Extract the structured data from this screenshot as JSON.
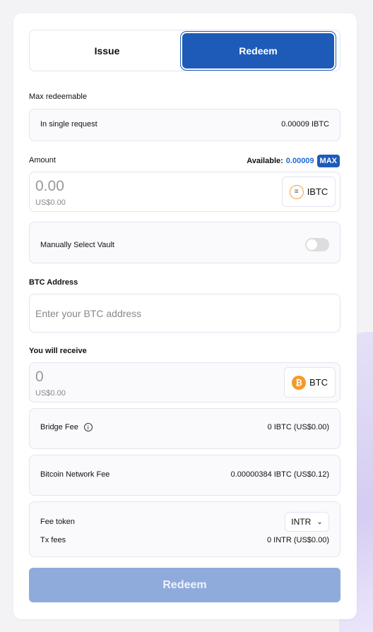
{
  "tabs": {
    "issue": "Issue",
    "redeem": "Redeem"
  },
  "max_redeemable": {
    "label": "Max redeemable",
    "row_label": "In single request",
    "row_value": "0.00009 IBTC"
  },
  "amount": {
    "label": "Amount",
    "available_label": "Available:",
    "available_value": "0.00009",
    "max_label": "MAX",
    "value": "0.00",
    "usd": "US$0.00",
    "token": "IBTC"
  },
  "vault": {
    "label": "Manually Select Vault",
    "enabled": false
  },
  "btc_address": {
    "label": "BTC Address",
    "placeholder": "Enter your BTC address"
  },
  "receive": {
    "label": "You will receive",
    "value": "0",
    "usd": "US$0.00",
    "token": "BTC"
  },
  "bridge_fee": {
    "label": "Bridge Fee",
    "value": "0 IBTC (US$0.00)"
  },
  "network_fee": {
    "label": "Bitcoin Network Fee",
    "value": "0.00000384 IBTC (US$0.12)"
  },
  "fee_token": {
    "label": "Fee token",
    "selected": "INTR",
    "tx_label": "Tx fees",
    "tx_value": "0 INTR (US$0.00)"
  },
  "submit_label": "Redeem",
  "colors": {
    "primary": "#1e5bb8",
    "disabled": "#8fabdc",
    "link": "#1e6ad1"
  }
}
